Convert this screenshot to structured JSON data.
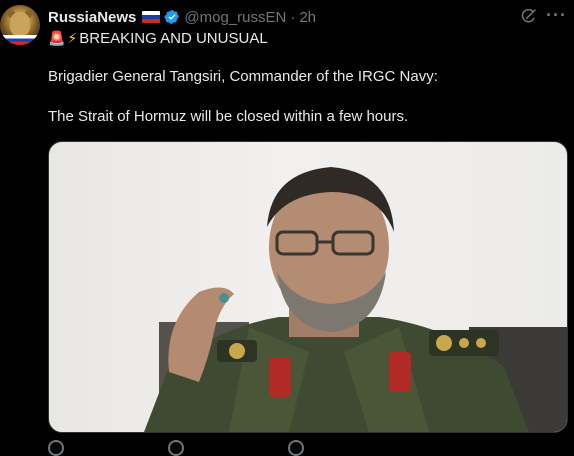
{
  "tweet": {
    "author_name": "RussiaNews",
    "author_flag": "russia-flag-icon",
    "handle": "@mog_russEN",
    "separator": "·",
    "time": "2h",
    "lines": [
      "BREAKING AND UNUSUAL",
      "Brigadier General Tangsiri, Commander of the IRGC Navy:",
      "The Strait of Hormuz will be closed within a few hours."
    ],
    "emojis": [
      "siren-icon",
      "lightning-icon"
    ]
  },
  "colors": {
    "background": "#000000",
    "text": "#e7e9ea",
    "secondary": "#71767b",
    "verified": "#1d9bf0"
  }
}
